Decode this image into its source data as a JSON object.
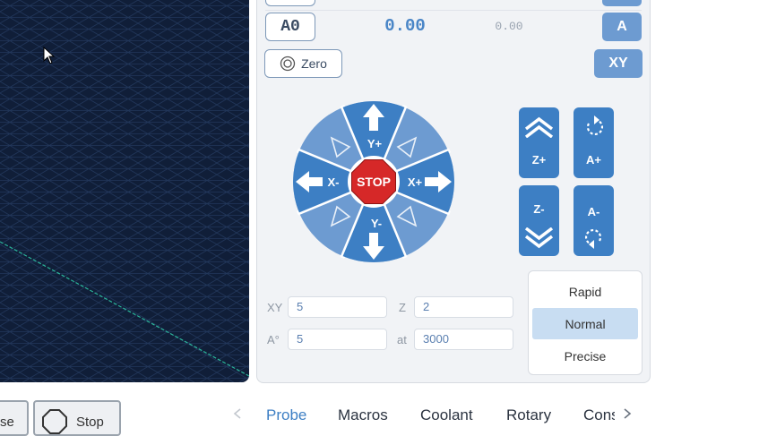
{
  "position": {
    "axis_label": "A0",
    "work_value": "0.00",
    "machine_value": "0.00",
    "zero_axis_label": "A"
  },
  "zero_button": {
    "label": "Zero"
  },
  "zero_xy_button": {
    "label": "XY"
  },
  "jog_pad": {
    "y_plus": "Y+",
    "y_minus": "Y-",
    "x_plus": "X+",
    "x_minus": "X-",
    "stop": "STOP",
    "z_plus": "Z+",
    "z_minus": "Z-",
    "a_plus": "A+",
    "a_minus": "A-"
  },
  "jog_settings": {
    "xy_label": "XY",
    "xy_value": "5",
    "z_label": "Z",
    "z_value": "2",
    "a_label": "A°",
    "a_value": "5",
    "feed_label": "at",
    "feed_value": "3000"
  },
  "speed_options": [
    {
      "label": "Rapid",
      "active": false
    },
    {
      "label": "Normal",
      "active": true
    },
    {
      "label": "Precise",
      "active": false
    }
  ],
  "bottom_buttons": {
    "pause_partial": "se",
    "stop_label": "Stop"
  },
  "tabs": [
    {
      "label": "Probe",
      "active": true
    },
    {
      "label": "Macros",
      "active": false
    },
    {
      "label": "Coolant",
      "active": false
    },
    {
      "label": "Rotary",
      "active": false
    },
    {
      "label": "Cons",
      "active": false
    }
  ],
  "icons": {
    "tab_prev": "chevron-left-icon",
    "tab_next": "chevron-right-icon",
    "zero": "target-icon",
    "stop": "octagon-icon",
    "cursor": "mouse-pointer-icon"
  },
  "colors": {
    "viewport_bg": "#101e38",
    "accent": "#3d7fc4",
    "accent_light": "#6d9bd1",
    "stop_red": "#d62828"
  }
}
